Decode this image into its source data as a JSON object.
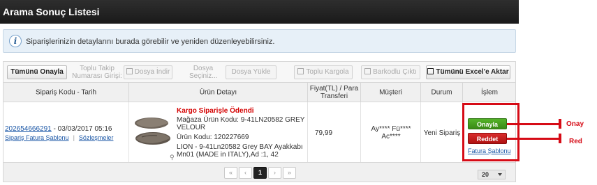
{
  "header": {
    "title": "Arama Sonuç Listesi"
  },
  "info": {
    "text": "Siparişlerinizin detaylarını burada görebilir ve yeniden düzenleyebilirsiniz."
  },
  "toolbar": {
    "approve_all": "Tümünü Onayla",
    "bulk_tracking_label": "Toplu Takip Numarası Girişi:",
    "file_download": "Dosya İndir",
    "choose_file_label": "Dosya Seçiniz...",
    "file_upload": "Dosya Yükle",
    "bulk_cargo": "Toplu Kargola",
    "barcode_print": "Barkodlu Çıktı",
    "export_excel": "Tümünü Excel'e Aktar"
  },
  "table": {
    "columns": {
      "order": "Sipariş Kodu - Tarih",
      "product": "Ürün Detayı",
      "price": "Fiyat(TL) / Para Transferi",
      "customer": "Müşteri",
      "status": "Durum",
      "action": "İşlem"
    },
    "row": {
      "order_code": "202654666291",
      "order_date": "- 03/03/2017 05:16",
      "invoice_template_link": "Sipariş Fatura Şablonu",
      "contracts_link": "Sözleşmeler",
      "product_title": "Kargo Siparişle Ödendi",
      "store_code": "Mağaza Ürün Kodu: 9-41LN20582 GREY",
      "store_code_cont": "VELOUR",
      "product_code": "Ürün Kodu: 120227669",
      "product_desc": "LION - 9-41Ln20582 Grey BAY Ayakkabı",
      "product_desc_cont": "Mn01 (MADE in ITALY),Ad :1, 42",
      "price": "79,99",
      "customer_line1": "Ay**** Fü****",
      "customer_line2": "Ac****",
      "status": "Yeni Sipariş",
      "approve_button": "Onayla",
      "reject_button": "Reddet",
      "invoice_template_button": "Fatura Şablonu"
    }
  },
  "annotations": {
    "approve": "Onay",
    "reject": "Red"
  },
  "pagination": {
    "first": "«",
    "prev": "‹",
    "current": "1",
    "next": "›",
    "last": "»",
    "per_page": "20"
  },
  "colors": {
    "titlebar": "#1f1f1f",
    "approve": "#43951e",
    "reject": "#c41b1b",
    "highlight": "#d60b16",
    "link": "#1a56a6"
  }
}
